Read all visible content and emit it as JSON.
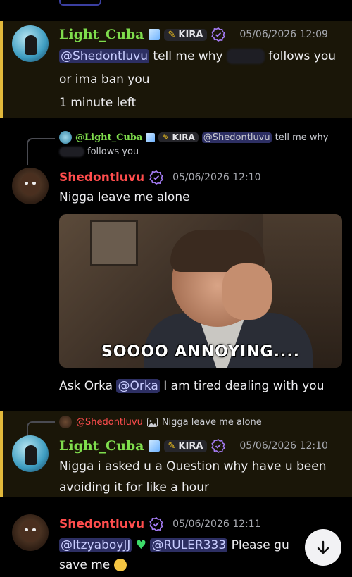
{
  "messages": [
    {
      "author": "Light_Cuba",
      "tag": "KIRA",
      "timestamp": "05/06/2026 12:09",
      "mention": "@Shedontluvu",
      "line1_a": "tell me why",
      "line1_b": "follows you",
      "line2": "or ima ban you",
      "line3": "1 minute left"
    },
    {
      "reply": {
        "author": "@Light_Cuba",
        "tag": "KIRA",
        "mention": "@Shedontluvu",
        "text_a": "tell me why",
        "text_b": "follows you"
      },
      "author": "Shedontluvu",
      "timestamp": "05/06/2026 12:10",
      "text": "Nigga leave me alone",
      "gif_caption": "SOOOO ANNOYING....",
      "follow_a": "Ask Orka",
      "follow_mention": "@Orka",
      "follow_b": "I am tired dealing with you"
    },
    {
      "reply": {
        "author": "@Shedontluvu",
        "text": "Nigga leave me alone"
      },
      "author": "Light_Cuba",
      "tag": "KIRA",
      "timestamp": "05/06/2026 12:10",
      "line1": "Nigga i asked u a Question why have u been",
      "line2": "avoiding it for like a hour"
    },
    {
      "author": "Shedontluvu",
      "timestamp": "05/06/2026 12:11",
      "mention1": "@ItzyaboyJJ",
      "mention2": "@RULER333",
      "text": "Please gu",
      "line2": "save me"
    }
  ],
  "colors": {
    "highlight_bg": "#1a1608",
    "highlight_bar": "#e2b93b",
    "mention_bg": "#2d2f63",
    "light_cuba_name": "#7fdd4d",
    "shed_name": "#ff4d4d"
  },
  "icons": [
    "verified-badge-icon",
    "ice-cube-icon",
    "pencil-tag-icon",
    "image-icon",
    "scroll-down-icon",
    "heart-icon",
    "emoji-icon"
  ]
}
